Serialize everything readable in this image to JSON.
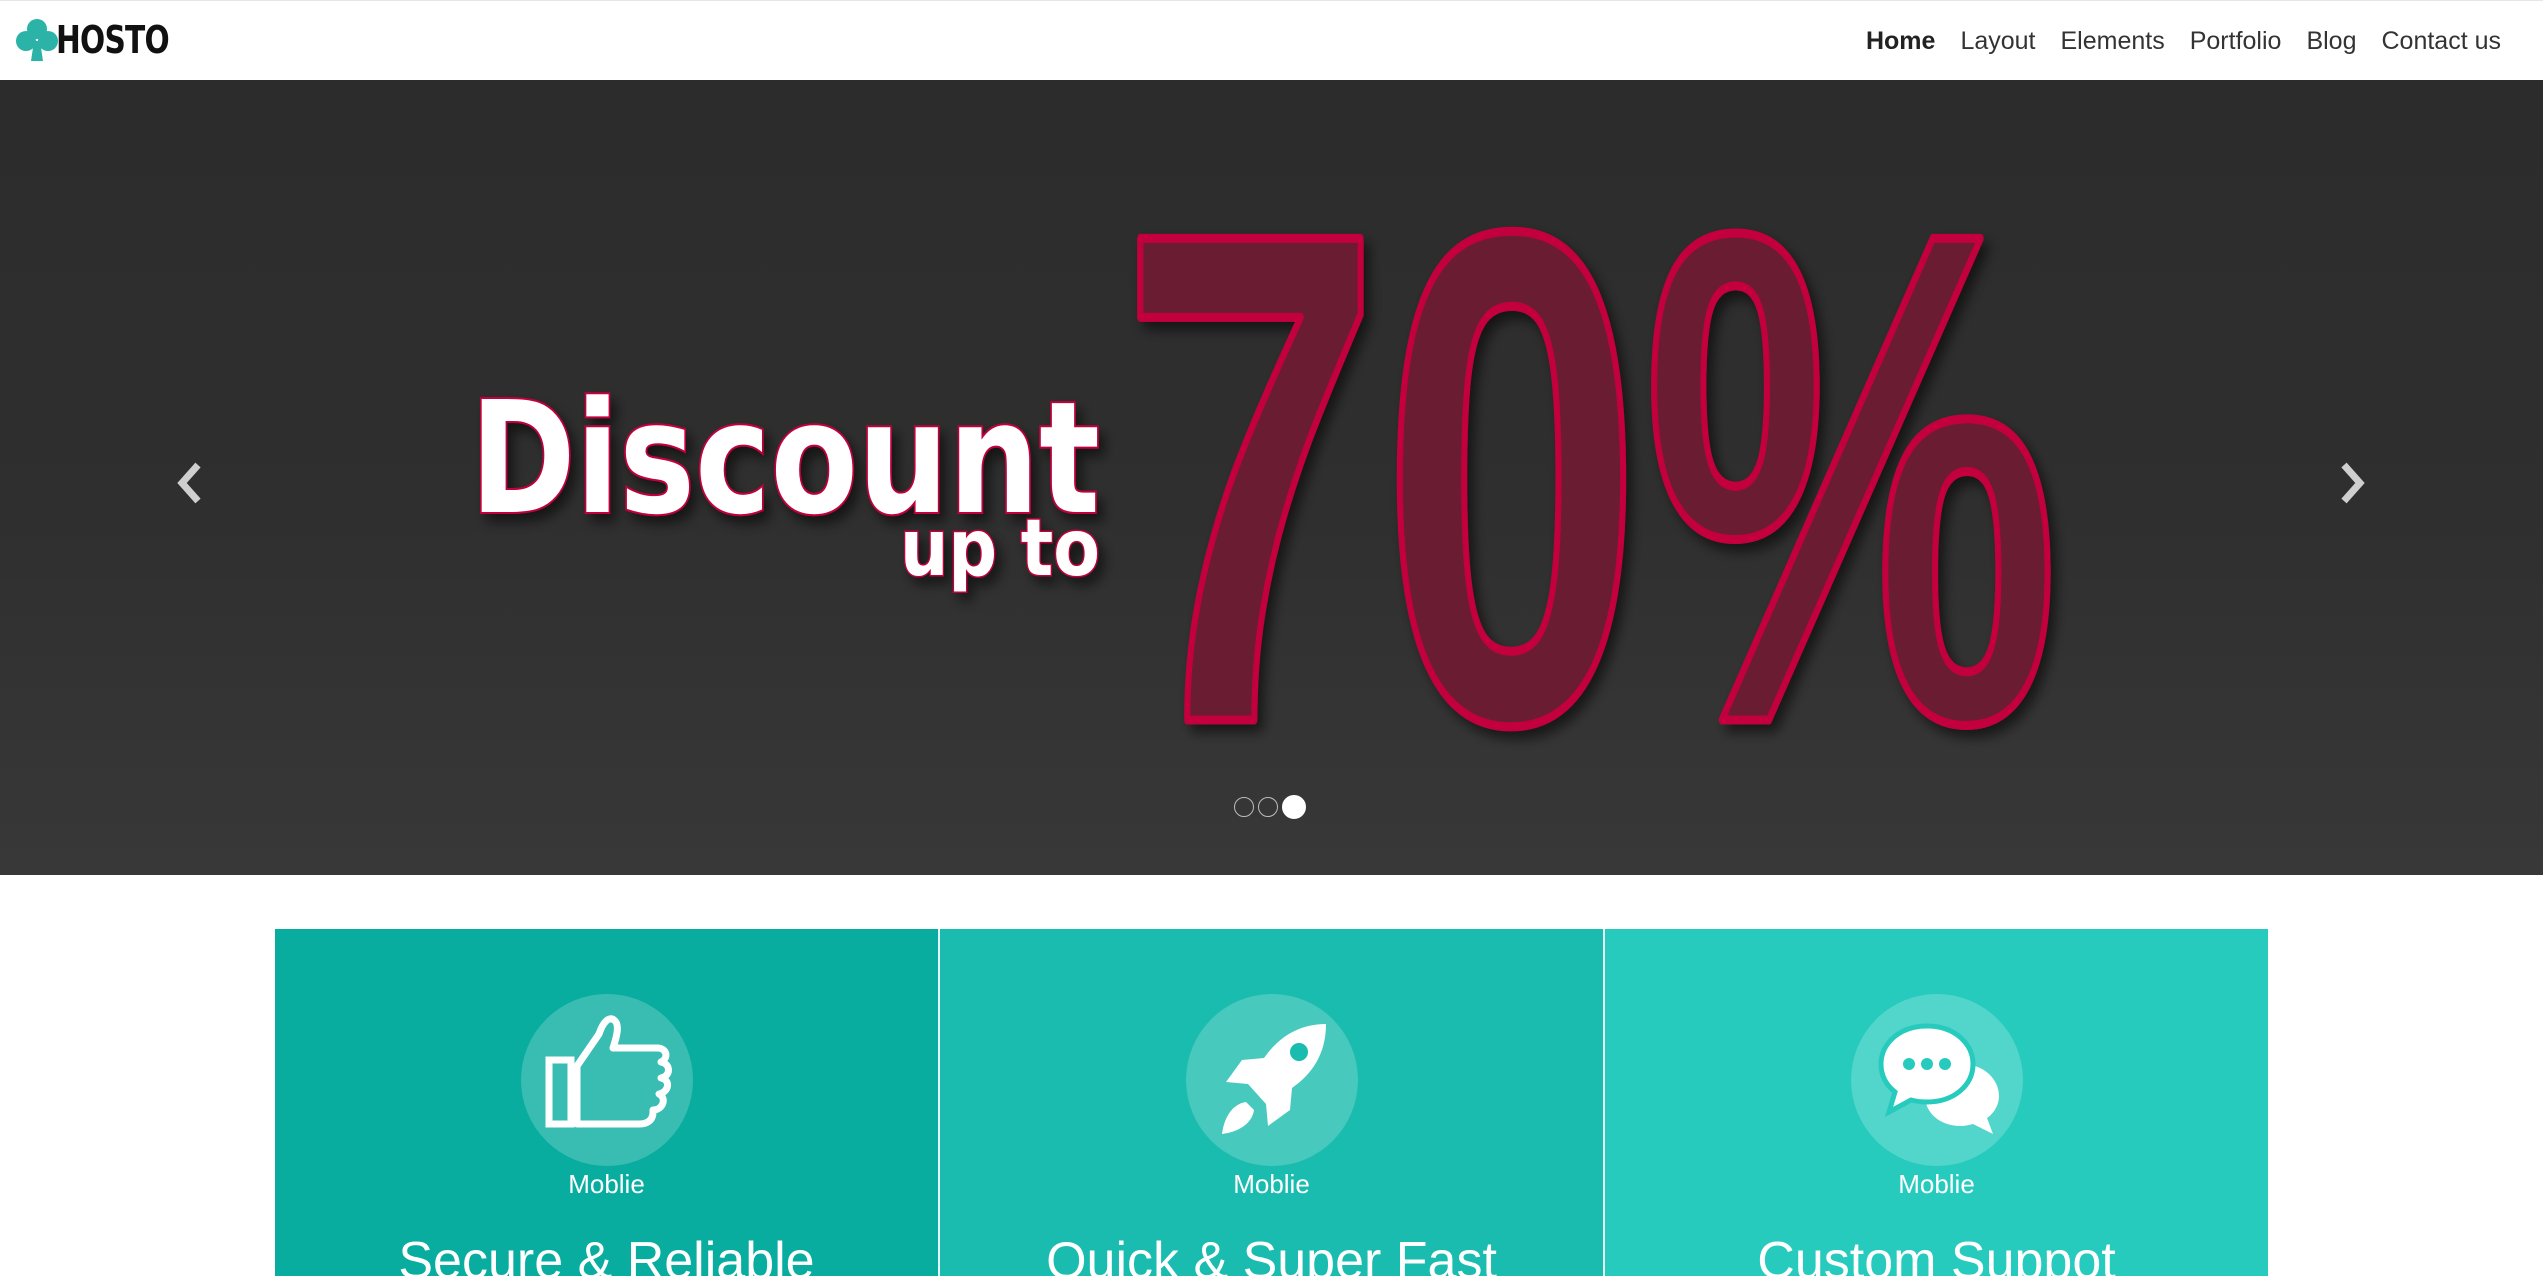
{
  "brand": {
    "name": "HOSTO",
    "accent": "#2ab3a6"
  },
  "nav": {
    "items": [
      {
        "label": "Home",
        "active": true
      },
      {
        "label": "Layout"
      },
      {
        "label": "Elements"
      },
      {
        "label": "Portfolio"
      },
      {
        "label": "Blog"
      },
      {
        "label": "Contact us"
      }
    ]
  },
  "hero": {
    "headline": "Discount",
    "subline": "up to",
    "value": "70%",
    "highlight_color": "#c3003c",
    "prev_icon": "chevron-left-icon",
    "next_icon": "chevron-right-icon",
    "slides": 3,
    "active_slide": 3
  },
  "features": [
    {
      "icon": "thumbs-up-icon",
      "subtitle": "Moblie",
      "title": "Secure & Reliable",
      "color": "#08ada0"
    },
    {
      "icon": "rocket-icon",
      "subtitle": "Moblie",
      "title": "Quick & Super Fast",
      "color": "#19bcae"
    },
    {
      "icon": "chat-bubbles-icon",
      "subtitle": "Moblie",
      "title": "Custom Suppot",
      "color": "#27cbbe"
    }
  ]
}
